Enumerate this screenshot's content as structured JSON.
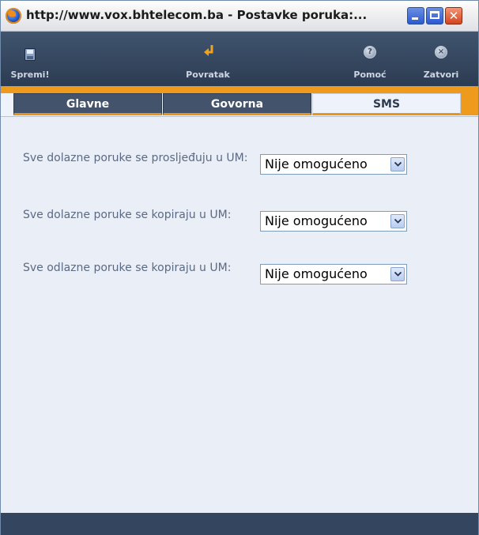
{
  "window": {
    "title": "http://www.vox.bhtelecom.ba - Postavke poruka:...",
    "minimize_glyph": "_",
    "close_glyph": "✕"
  },
  "toolbar": {
    "save_label": "Spremi!",
    "back_label": "Povratak",
    "help_label": "Pomoć",
    "close_label": "Zatvori",
    "help_glyph": "?",
    "close_glyph": "×"
  },
  "tabs": [
    {
      "label": "Glavne",
      "active": false
    },
    {
      "label": "Govorna",
      "active": false
    },
    {
      "label": "SMS",
      "active": true
    }
  ],
  "settings": [
    {
      "label": "Sve dolazne poruke se prosljeđuju u UM:",
      "value": "Nije omogućeno"
    },
    {
      "label": "Sve dolazne poruke se kopiraju u UM:",
      "value": "Nije omogućeno"
    },
    {
      "label": "Sve odlazne poruke se kopiraju u UM:",
      "value": "Nije omogućeno"
    }
  ],
  "colors": {
    "toolbar": "#34465f",
    "accent_orange": "#ee9a1c",
    "content_bg": "#eaeef6",
    "label_text": "#5b6a84"
  },
  "icons": {
    "window": "firefox-icon",
    "save": "floppy-disk-icon",
    "back": "return-arrow-icon",
    "help": "question-circle-icon",
    "close": "x-circle-icon",
    "dropdown": "chevron-down-icon"
  }
}
